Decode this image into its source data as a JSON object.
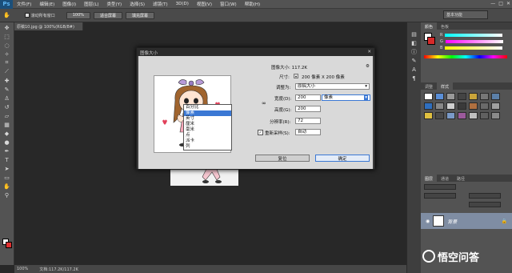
{
  "menubar": {
    "logo": "Ps",
    "items": [
      "文件(F)",
      "编辑(E)",
      "图像(I)",
      "图层(L)",
      "类型(Y)",
      "选择(S)",
      "滤镜(T)",
      "3D(D)",
      "视图(V)",
      "窗口(W)",
      "帮助(H)"
    ],
    "minimize": "—",
    "maximize": "□",
    "close": "✕"
  },
  "options": {
    "check_label": "滚动所有窗口",
    "zoom_btn": "100%",
    "fit_btn": "适合屏幕",
    "fill_btn": "填充屏幕",
    "workspace": "基本功能"
  },
  "doc": {
    "tab": "原稿10.jpg @ 100%(RGB/8#)"
  },
  "status": {
    "zoom": "100%",
    "doc": "文档:117.2K/117.2K"
  },
  "color_panel": {
    "tabs": [
      "颜色",
      "色板"
    ],
    "channels": [
      "R",
      "G",
      "B"
    ],
    "values": [
      "",
      "",
      " "
    ]
  },
  "styles_panel": {
    "tabs": [
      "调整",
      "样式"
    ]
  },
  "layers_panel": {
    "tabs": [
      "图层",
      "通道",
      "路径"
    ],
    "layer_name": "背景"
  },
  "dialog": {
    "title": "图像大小",
    "size_label": "图像大小: 117.2K",
    "dims_label": "尺寸:",
    "dims_value": "200 像素 X 200 像素",
    "fit_label": "调整为:",
    "fit_value": "原稿大小",
    "width_label": "宽度(D):",
    "width_value": "200",
    "unit_value": "像素",
    "height_label": "高度(G):",
    "height_value": "200",
    "res_label": "分辨率(R):",
    "res_value": "72",
    "resample_label": "重新采样(S):",
    "resample_value": "自动",
    "reset_btn": "复位",
    "ok_btn": "确定",
    "unit_options": [
      "百分比",
      "像素",
      "英寸",
      "厘米",
      "毫米",
      "点",
      "派卡",
      "列"
    ],
    "unit_selected_index": 1
  },
  "watermark": {
    "text": "悟空问答"
  },
  "colors": {
    "accent": "#3b78d4",
    "layer_sel": "#7f8da3"
  }
}
